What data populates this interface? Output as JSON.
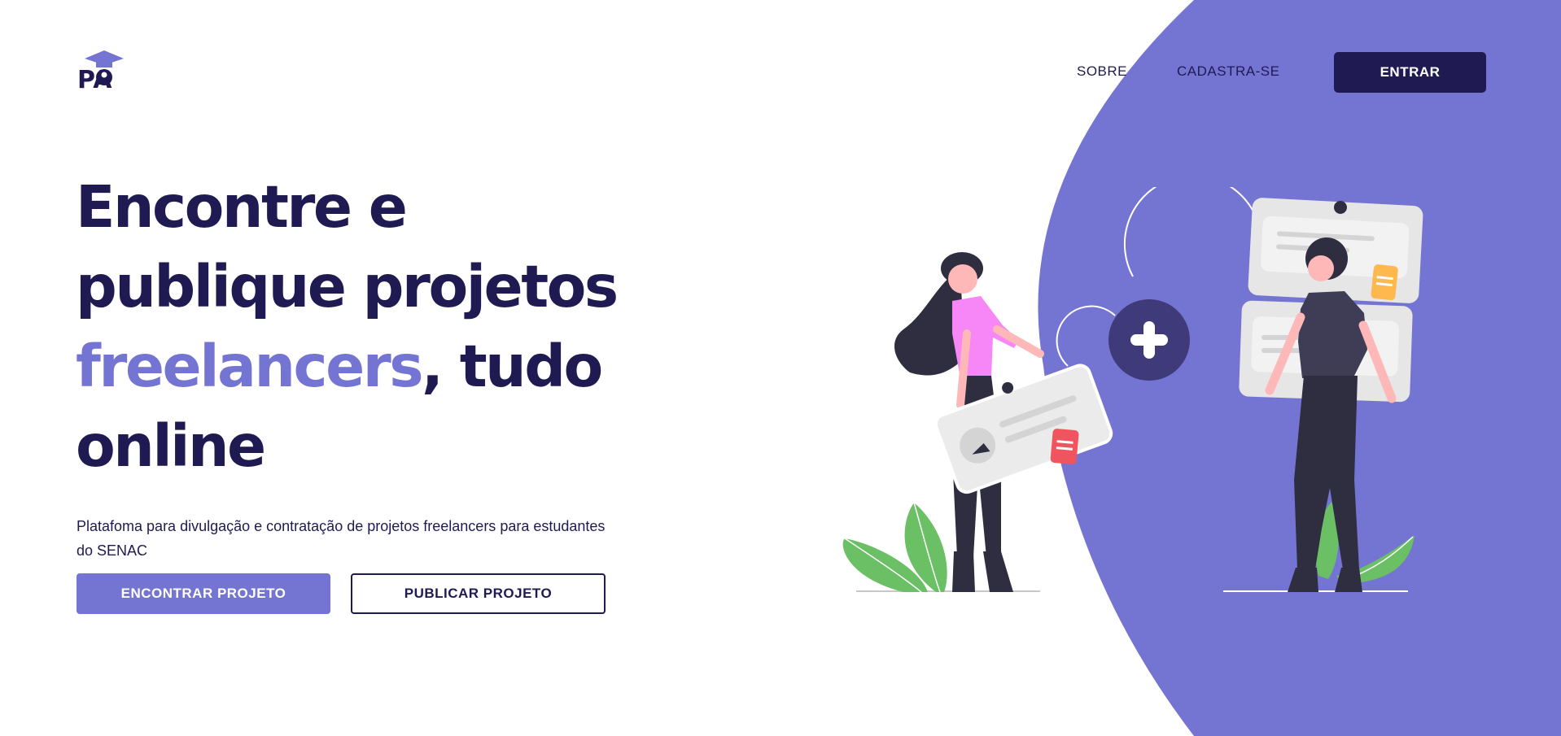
{
  "brand": {
    "logo_text": "PA",
    "accent_color": "#7474d2",
    "dark_color": "#1f1b52"
  },
  "nav": {
    "links": [
      {
        "label": "SOBRE"
      },
      {
        "label": "CADASTRA-SE"
      }
    ],
    "login_label": "ENTRAR"
  },
  "hero": {
    "title_line1": "Encontre e",
    "title_line2": "publique projetos",
    "title_accent": "freelancers",
    "title_line3_rest": ", tudo",
    "title_line4": "online",
    "subtitle": "Platafoma para divulgação e contratação de projetos freelancers para estudantes do SENAC",
    "primary_button": "ENCONTRAR PROJETO",
    "secondary_button": "PUBLICAR PROJETO"
  }
}
